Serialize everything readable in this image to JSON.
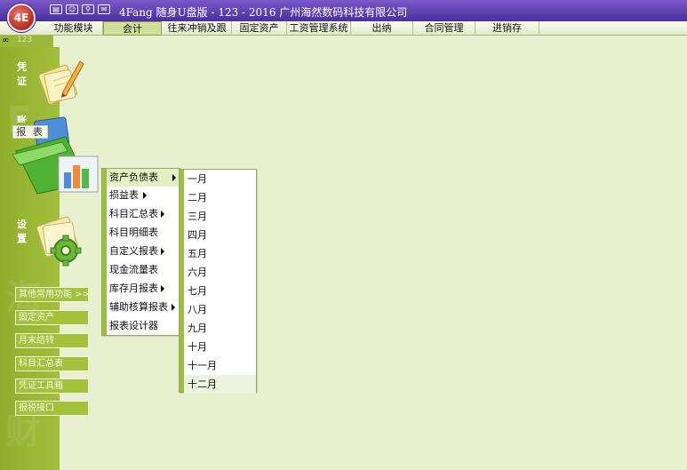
{
  "app": {
    "logo_text": "4E",
    "title": "4Fang 随身U盘版  - 123 - 2016 广州海然数码科技有限公司",
    "title_icons": [
      "window-icon",
      "users-icon",
      "user-icon",
      "mail-icon"
    ],
    "version": "123"
  },
  "menubar": {
    "tabs": [
      {
        "label": "功能模块"
      },
      {
        "label": "会计",
        "active": true
      },
      {
        "label": "往来冲销及跟"
      },
      {
        "label": "固定资产"
      },
      {
        "label": "工资管理系统"
      },
      {
        "label": "出纳"
      },
      {
        "label": "合同管理"
      },
      {
        "label": "进销存"
      }
    ]
  },
  "sidebar": {
    "voucher_label": "凭证",
    "ledger_label_partial": "账",
    "report_label": "报 表",
    "settings_label": "设置",
    "buttons": [
      {
        "label": "其他常用功能 >>"
      },
      {
        "label": "固定资产"
      },
      {
        "label": "月末结转"
      },
      {
        "label": "科目汇总表"
      },
      {
        "label": "凭证工具箱"
      },
      {
        "label": "报税接口"
      }
    ]
  },
  "report_menu": {
    "items": [
      {
        "label": "资产负债表",
        "submenu": true,
        "selected": true
      },
      {
        "label": "损益表",
        "submenu": true
      },
      {
        "label": "科目汇总表",
        "submenu": true
      },
      {
        "label": "科目明细表",
        "submenu": false
      },
      {
        "label": "自定义报表",
        "submenu": true
      },
      {
        "label": "现金流量表",
        "submenu": false
      },
      {
        "label": "库存月报表",
        "submenu": true
      },
      {
        "label": "辅助核算报表",
        "submenu": true
      },
      {
        "label": "报表设计器",
        "submenu": false
      }
    ]
  },
  "month_menu": {
    "items": [
      "一月",
      "二月",
      "三月",
      "四月",
      "五月",
      "六月",
      "七月",
      "八月",
      "九月",
      "十月",
      "十一月",
      "十二月"
    ],
    "hover_index": 11
  },
  "colors": {
    "background": "#e8f0cf",
    "sidebar": "#9bb83b",
    "titlebar": "#5a3fb0",
    "menu_stripe": "#9bbf3a"
  }
}
